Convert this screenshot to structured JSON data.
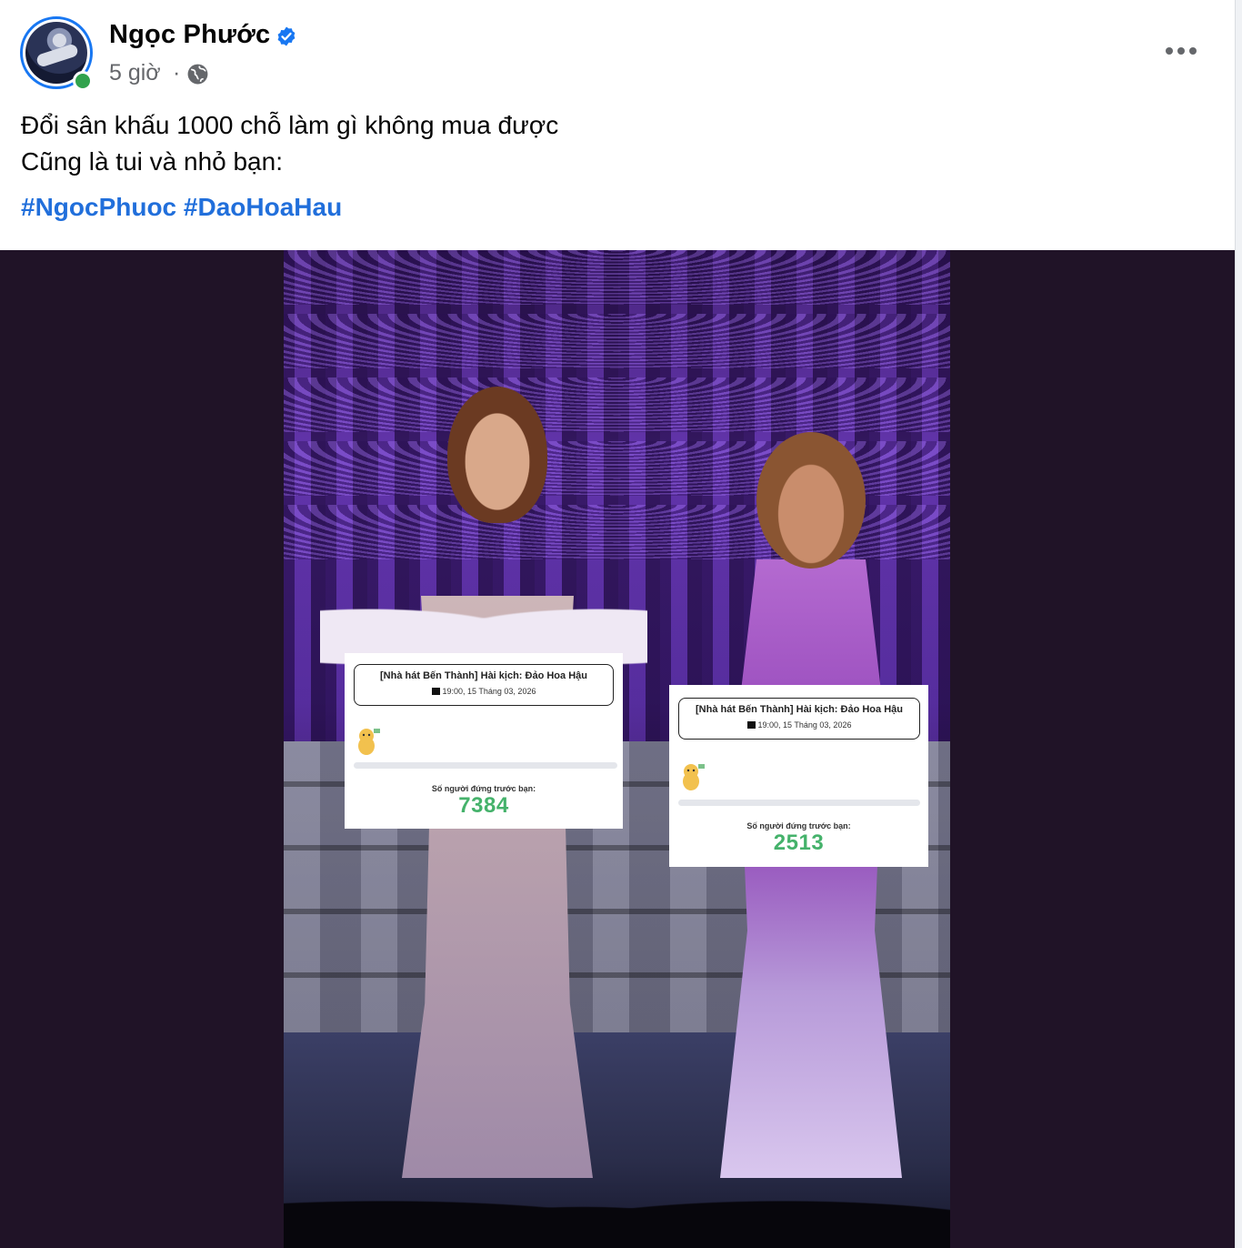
{
  "post": {
    "author_name": "Ngọc Phước",
    "time": "5 giờ",
    "separator": "·",
    "privacy_icon": "globe-icon",
    "verified_icon": "verified-badge-icon",
    "more_icon": "more-options-icon",
    "text_line1": "Đổi sân khấu 1000 chỗ làm gì không mua được",
    "text_line2": "Cũng là tui và nhỏ bạn:",
    "hashtags": [
      "#NgocPhuoc",
      "#DaoHoaHau"
    ]
  },
  "queue_cards": [
    {
      "event_title": "[Nhà hát Bến Thành] Hài kịch: Đảo Hoa Hậu",
      "event_time": "19:00, 15 Tháng 03, 2026",
      "ahead_label": "Số người đứng trước bạn:",
      "ahead_count": "7384",
      "progress": 0
    },
    {
      "event_title": "[Nhà hát Bến Thành] Hài kịch: Đảo Hoa Hậu",
      "event_time": "19:00, 15 Tháng 03, 2026",
      "ahead_label": "Số người đứng trước bạn:",
      "ahead_count": "2513",
      "progress": 0
    }
  ],
  "colors": {
    "link_blue": "#216fdb",
    "verified_blue": "#1877f2",
    "online_green": "#31a24c",
    "count_green": "#45b26b",
    "media_bg": "#201327"
  }
}
